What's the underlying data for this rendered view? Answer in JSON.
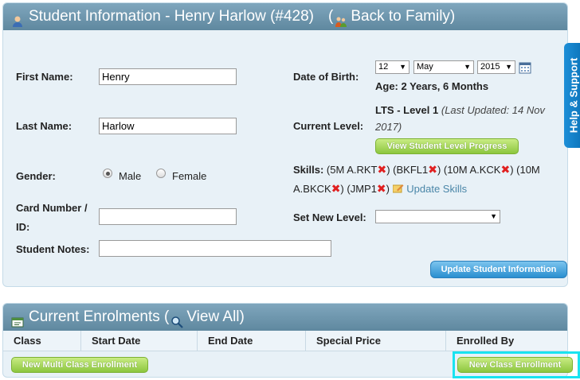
{
  "student_panel": {
    "title": "Student Information - Henry Harlow (#428)",
    "back_link": "(",
    "back_label": "Back to Family)"
  },
  "form": {
    "first_name_label": "First Name:",
    "first_name_value": "Henry",
    "last_name_label": "Last Name:",
    "last_name_value": "Harlow",
    "gender_label": "Gender:",
    "gender_options": [
      "Male",
      "Female"
    ],
    "gender_selected": "Male",
    "card_label_1": "Card Number /",
    "card_label_2": "ID:",
    "card_value": "",
    "notes_label": "Student Notes:",
    "notes_value": "",
    "dob_label": "Date of Birth:",
    "dob_day": "12",
    "dob_month": "May",
    "dob_year": "2015",
    "age_text": "Age: 2 Years, 6 Months",
    "current_level_label": "Current Level:",
    "current_level_value": "LTS - Level 1",
    "current_level_updated_1": "(Last Updated: 14 Nov",
    "current_level_updated_2": "2017)",
    "view_progress_button": "View Student Level Progress",
    "skills_label": "Skills:",
    "skills": [
      "(5M A.RKT",
      ") (BKFL1",
      ") (10M A.KCK",
      ") (10M",
      "A.BKCK",
      ") (JMP1",
      ")"
    ],
    "update_skills_link": "Update Skills",
    "set_level_label": "Set New Level:",
    "set_level_value": "",
    "update_button": "Update Student Information"
  },
  "help_tab": "Help & Support",
  "enrolments_panel": {
    "title_prefix": "Current Enrolments (",
    "view_all": "View All)",
    "columns": [
      "Class",
      "Start Date",
      "End Date",
      "Special Price",
      "Enrolled By"
    ],
    "new_multi_button": "New Multi Class Enrollment",
    "new_class_button": "New Class Enrollment"
  },
  "colors": {
    "header_blue": "#6a93aa",
    "panel_bg": "#e8f1f7",
    "green_button": "#8cc63e",
    "blue_button": "#2a8fd0",
    "highlight": "#19e3f0"
  }
}
